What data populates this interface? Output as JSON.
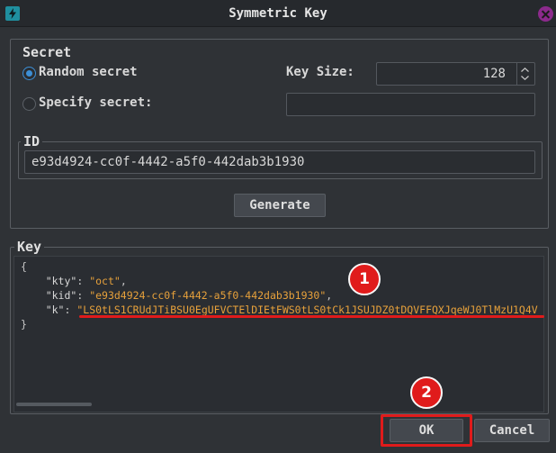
{
  "window": {
    "title": "Symmetric Key",
    "app_icon": "bolt-icon",
    "close_icon": "close-icon"
  },
  "secret": {
    "group_title": "Secret",
    "random_label": "Random secret",
    "specify_label": "Specify secret:",
    "key_size_label": "Key Size:",
    "key_size_value": "128",
    "specify_value": "",
    "random_selected": true
  },
  "id_group": {
    "title": "ID",
    "value": "e93d4924-cc0f-4442-a5f0-442dab3b1930"
  },
  "generate": {
    "label": "Generate"
  },
  "key_group": {
    "title": "Key",
    "open_brace": "{",
    "close_brace": "}",
    "lines": [
      {
        "key": "\"kty\"",
        "sep": ": ",
        "value": "\"oct\"",
        "trail": ","
      },
      {
        "key": "\"kid\"",
        "sep": ": ",
        "value": "\"e93d4924-cc0f-4442-a5f0-442dab3b1930\"",
        "trail": ","
      },
      {
        "key": "\"k\"",
        "sep": ": ",
        "value": "\"LS0tLS1CRUdJTiBSU0EgUFVCTElDIEtFWS0tLS0tCk1JSUJDZ0tDQVFFQXJqeWJ0TlMzU1Q4V",
        "trail": ""
      }
    ]
  },
  "footer": {
    "ok_label": "OK",
    "cancel_label": "Cancel"
  },
  "annotations": {
    "badge1": "1",
    "badge2": "2",
    "color": "#e01b1b"
  }
}
